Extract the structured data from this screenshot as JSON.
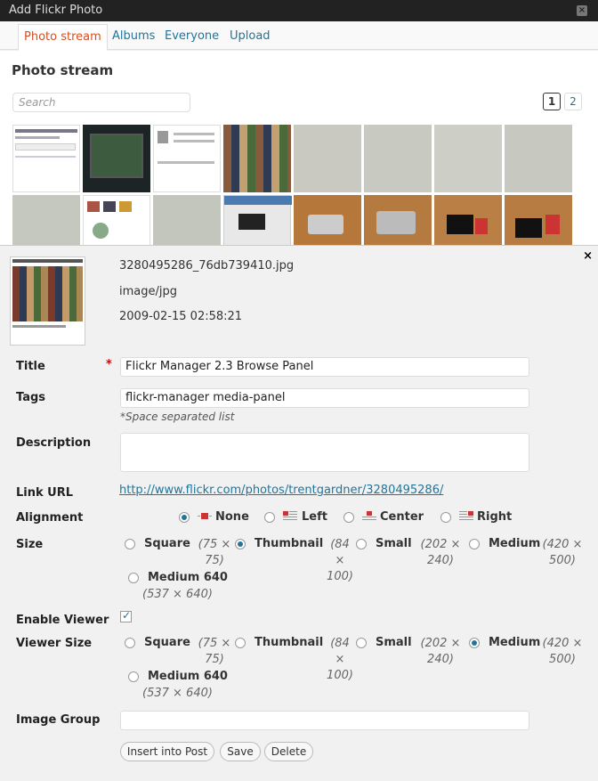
{
  "window": {
    "title": "Add Flickr Photo"
  },
  "tabs": [
    "Photo stream",
    "Albums",
    "Everyone",
    "Upload"
  ],
  "section_title": "Photo stream",
  "search": {
    "placeholder": "Search"
  },
  "pagination": {
    "current": "1",
    "other": "2"
  },
  "photo": {
    "filename": "3280495286_76db739410.jpg",
    "mime": "image/jpg",
    "date": "2009-02-15 02:58:21"
  },
  "form": {
    "title_label": "Title",
    "title_required": "*",
    "title_value": "Flickr Manager 2.3 Browse Panel",
    "tags_label": "Tags",
    "tags_value": "flickr-manager media-panel",
    "tags_hint": "*Space separated list",
    "description_label": "Description",
    "description_value": "",
    "link_label": "Link URL",
    "link_value": "http://www.flickr.com/photos/trentgardner/3280495286/",
    "alignment_label": "Alignment",
    "alignment_options": [
      "None",
      "Left",
      "Center",
      "Right"
    ],
    "alignment_selected": "None",
    "size_label": "Size",
    "sizes": [
      {
        "name": "Square",
        "dims": "(75 × 75)"
      },
      {
        "name": "Thumbnail",
        "dims": "(84 × 100)"
      },
      {
        "name": "Small",
        "dims": "(202 × 240)"
      },
      {
        "name": "Medium",
        "dims": "(420 × 500)"
      },
      {
        "name": "Medium 640",
        "dims": "(537 × 640)"
      }
    ],
    "size_selected": "Thumbnail",
    "viewer_label": "Enable Viewer",
    "viewer_enabled": true,
    "viewer_size_label": "Viewer Size",
    "viewer_size_selected": "Medium",
    "image_group_label": "Image Group",
    "image_group_value": ""
  },
  "buttons": {
    "insert": "Insert into Post",
    "save": "Save",
    "delete": "Delete"
  },
  "colors": {
    "accent": "#21759b",
    "active_tab": "#d54e21",
    "titlebar": "#222222",
    "required": "#dd0000"
  }
}
